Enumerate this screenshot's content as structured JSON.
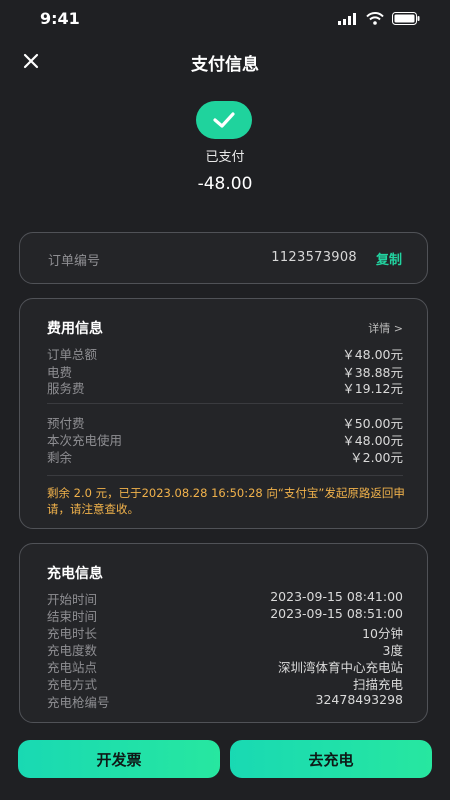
{
  "status_bar": {
    "time": "9:41"
  },
  "header": {
    "title": "支付信息"
  },
  "payment": {
    "status": "已支付",
    "amount": "-48.00"
  },
  "order": {
    "label": "订单编号",
    "number": "1123573908",
    "copy_label": "复制"
  },
  "fee": {
    "title": "费用信息",
    "detail_label": "详情 >",
    "rows": [
      {
        "label": "订单总额",
        "value": "￥48.00元"
      },
      {
        "label": "电费",
        "value": "￥38.88元"
      },
      {
        "label": "服务费",
        "value": "￥19.12元"
      }
    ],
    "prepay_rows": [
      {
        "label": "预付费",
        "value": "￥50.00元"
      },
      {
        "label": "本次充电使用",
        "value": "￥48.00元"
      },
      {
        "label": "剩余",
        "value": "￥2.00元"
      }
    ],
    "notice": "剩余 2.0 元，已于2023.08.28 16:50:28 向“支付宝”发起原路返回申请，请注意查收。"
  },
  "charging": {
    "title": "充电信息",
    "rows": [
      {
        "label": "开始时间",
        "value": "2023-09-15 08:41:00"
      },
      {
        "label": "结束时间",
        "value": "2023-09-15 08:51:00"
      },
      {
        "label": "充电时长",
        "value": "10分钟"
      },
      {
        "label": "充电度数",
        "value": "3度"
      },
      {
        "label": "充电站点",
        "value": "深圳湾体育中心充电站"
      },
      {
        "label": "充电方式",
        "value": "扫描充电"
      },
      {
        "label": "充电枪编号",
        "value": "32478493298"
      }
    ]
  },
  "actions": {
    "invoice_label": "开发票",
    "charge_label": "去充电"
  },
  "colors": {
    "accent": "#1fd39d",
    "notice": "#f1b24b",
    "background": "#1f2023"
  }
}
